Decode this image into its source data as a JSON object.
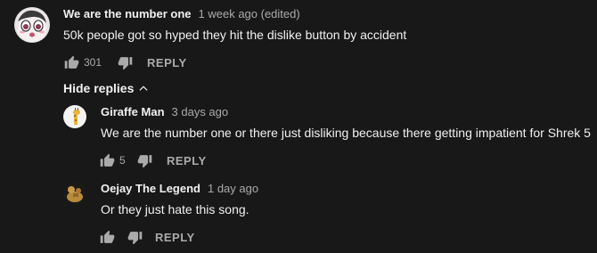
{
  "comments": [
    {
      "author": "We are the number one",
      "time": "1 week ago (edited)",
      "text": "50k people got so hyped they hit the dislike button by accident",
      "likes": "301",
      "reply_label": "REPLY"
    }
  ],
  "hide_replies_label": "Hide replies",
  "replies": [
    {
      "author": "Giraffe Man",
      "time": "3 days ago",
      "text": "We are the number one or there just disliking because there getting impatient for Shrek 5",
      "likes": "5",
      "reply_label": "REPLY"
    },
    {
      "author": "Oejay The Legend",
      "time": "1 day ago",
      "text": "Or they just hate this song.",
      "likes": "",
      "reply_label": "REPLY"
    }
  ],
  "colors": {
    "background": "#181818",
    "primary_text": "#f1f1f1",
    "secondary_text": "#aaaaaa"
  },
  "icons": [
    "thumbs-up-icon",
    "thumbs-down-icon",
    "chevron-up-icon"
  ]
}
